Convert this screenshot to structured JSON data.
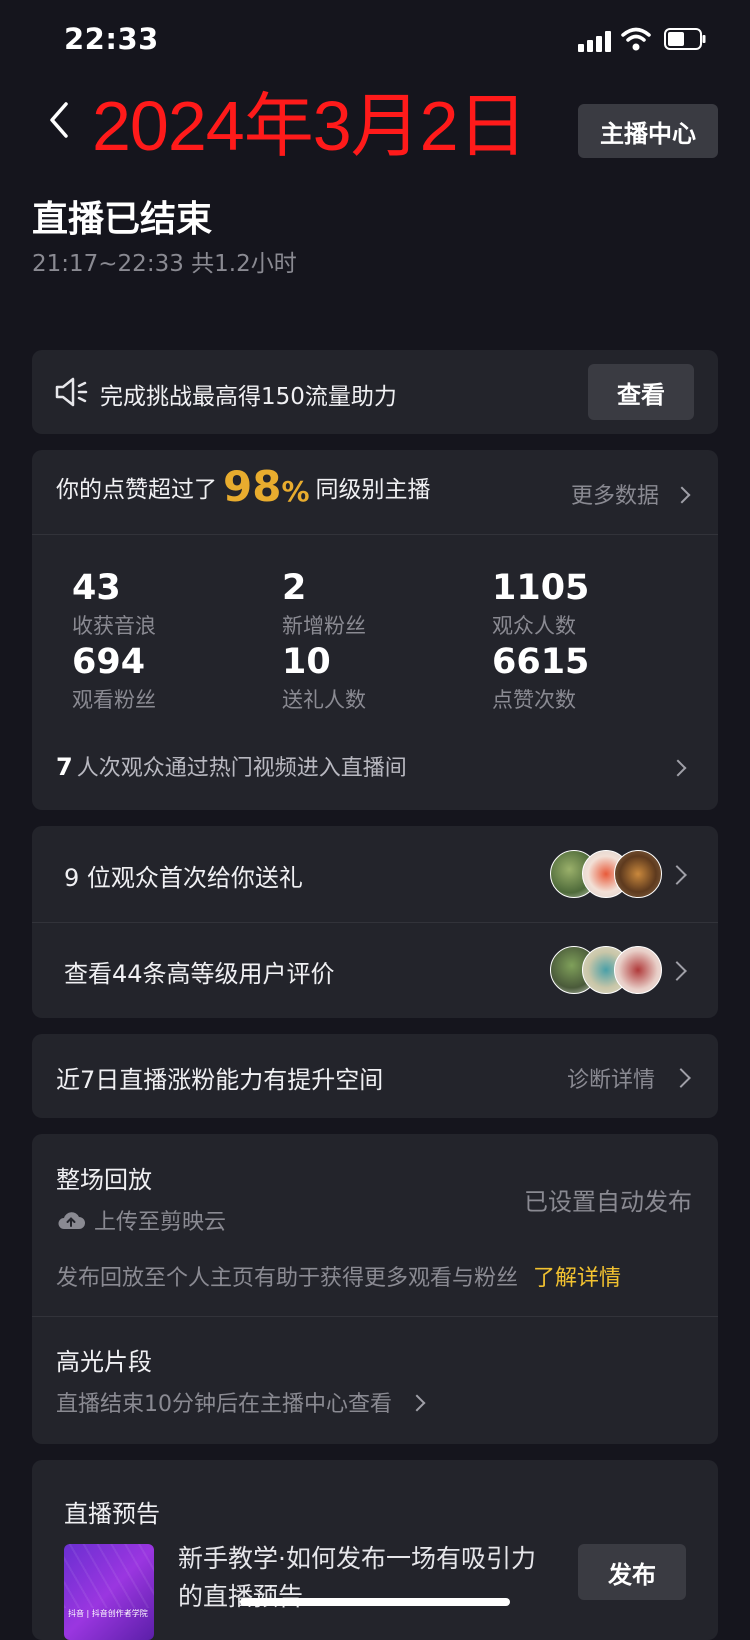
{
  "status_bar": {
    "time": "22:33"
  },
  "header": {
    "date": "2024年3月2日",
    "center_button": "主播中心",
    "title": "直播已结束",
    "duration": "21:17~22:33 共1.2小时"
  },
  "challenge": {
    "text": "完成挑战最高得150流量助力",
    "button": "查看"
  },
  "likes": {
    "prefix": "你的点赞超过了",
    "percent": "98",
    "percent_sign": "%",
    "suffix": "同级别主播",
    "more": "更多数据"
  },
  "stats": [
    {
      "value": "43",
      "label": "收获音浪"
    },
    {
      "value": "2",
      "label": "新增粉丝"
    },
    {
      "value": "1105",
      "label": "观众人数"
    },
    {
      "value": "694",
      "label": "观看粉丝"
    },
    {
      "value": "10",
      "label": "送礼人数"
    },
    {
      "value": "6615",
      "label": "点赞次数"
    }
  ],
  "hot_video": {
    "count": "7",
    "text": "人次观众通过热门视频进入直播间"
  },
  "gifts": {
    "first_gift": "9 位观众首次给你送礼",
    "reviews": "查看44条高等级用户评价"
  },
  "ability": {
    "text": "近7日直播涨粉能力有提升空间",
    "link": "诊断详情"
  },
  "playback": {
    "title": "整场回放",
    "upload": "上传至剪映云",
    "auto_publish": "已设置自动发布",
    "hint": "发布回放至个人主页有助于获得更多观看与粉丝",
    "learn_more": "了解详情",
    "highlight_title": "高光片段",
    "highlight_hint": "直播结束10分钟后在主播中心查看"
  },
  "preview": {
    "title": "直播预告",
    "tutorial": "新手教学·如何发布一场有吸引力的直播预告",
    "thumb_text": "抖音 | 抖音创作者学院",
    "button": "发布"
  },
  "colors": {
    "accent_yellow": "#e8ac2e",
    "date_red": "#ff1a1a",
    "card_bg": "#23242b",
    "page_bg": "#15151d"
  }
}
